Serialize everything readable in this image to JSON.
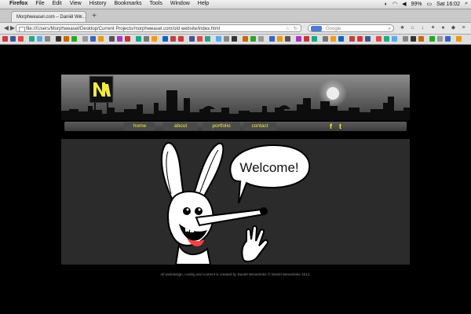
{
  "os_menubar": {
    "app_name": "Firefox",
    "menus": [
      "File",
      "Edit",
      "View",
      "History",
      "Bookmarks",
      "Tools",
      "Window",
      "Help"
    ],
    "battery": "99%",
    "clock": "Sat 16:02"
  },
  "browser": {
    "tab_title": "Morphweasel.com – Daniël We...",
    "url": "file:///Users/Morphweasel/Desktop/Current Projects/morphweasel.com/old website/index.html",
    "search_placeholder": "Google"
  },
  "site": {
    "nav": {
      "home": "home",
      "about": "about",
      "portfolio": "portfolio",
      "contact": "contact",
      "facebook": "f",
      "twitter": "t"
    },
    "speech_bubble": "Welcome!",
    "footer": "All webdesign, coding and content is created by Daniël Wevertinke © Daniël Wevertinke 2012."
  },
  "colors": {
    "accent_yellow": "#f1ec36",
    "page_bg": "#000000",
    "content_bg": "#2b2b2b"
  }
}
